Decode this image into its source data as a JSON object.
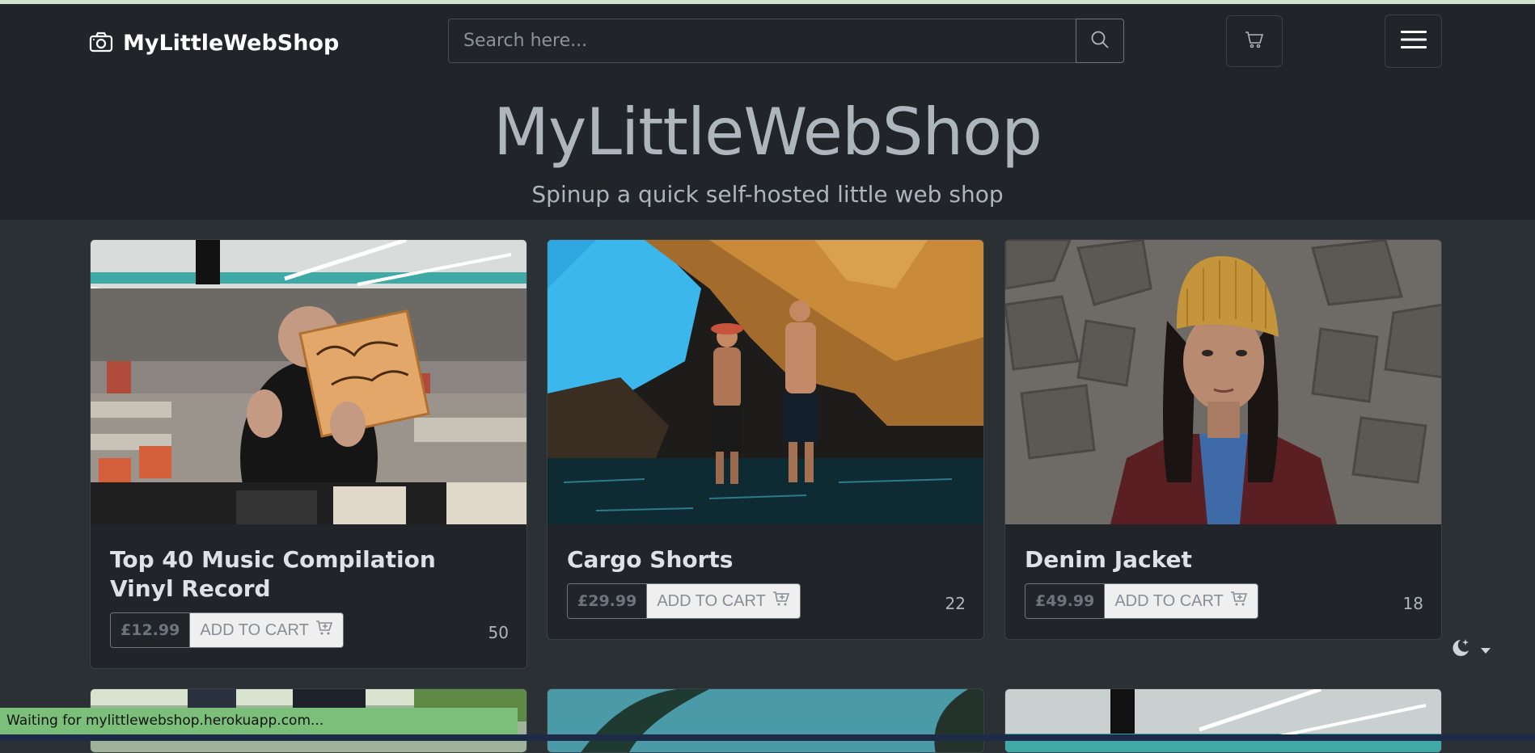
{
  "navbar": {
    "brand": "MyLittleWebShop",
    "search_placeholder": "Search here...",
    "icons": {
      "brand": "camera-icon",
      "search": "search-icon",
      "cart": "cart-icon",
      "menu": "hamburger-menu-icon"
    }
  },
  "hero": {
    "title": "MyLittleWebShop",
    "subtitle": "Spinup a quick self-hosted little web shop"
  },
  "products": [
    {
      "title": "Top 40 Music Compilation Vinyl Record",
      "price": "£12.99",
      "add_label": "ADD TO CART",
      "stock": "50"
    },
    {
      "title": "Cargo Shorts",
      "price": "£29.99",
      "add_label": "ADD TO CART",
      "stock": "22"
    },
    {
      "title": "Denim Jacket",
      "price": "£49.99",
      "add_label": "ADD TO CART",
      "stock": "18"
    }
  ],
  "theme_toggle": {
    "icon": "moon-stars-icon",
    "caret": "caret-down-icon"
  },
  "status_bar": {
    "text": "Waiting for mylittlewebshop.herokuapp.com..."
  },
  "colors": {
    "navbar_bg": "#212529",
    "page_bg": "#2b3035",
    "status_bar": "#7bbf7b"
  }
}
